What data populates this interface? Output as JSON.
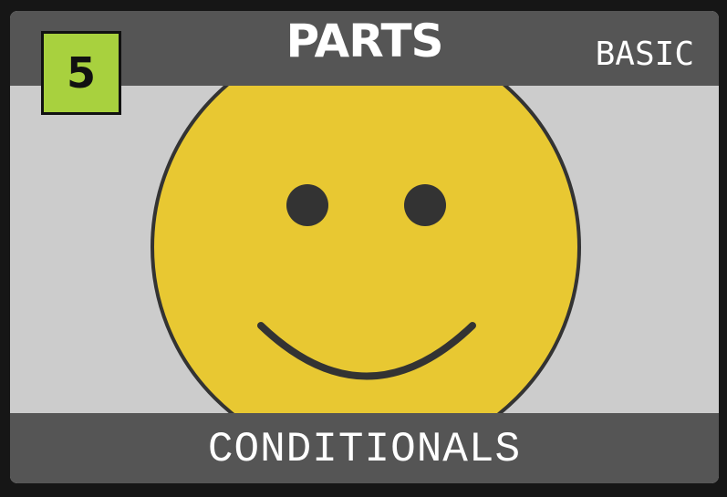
{
  "card": {
    "title": "PARTS",
    "difficulty": "BASIC",
    "level": "5",
    "category": "CONDITIONALS",
    "illustration_icon": "smiley-face-icon"
  },
  "colors": {
    "background": "#161616",
    "card_bg": "#cccccc",
    "bar": "#555555",
    "badge": "#a8d13e",
    "face": "#e8c832",
    "outline": "#333333",
    "text": "#ffffff"
  }
}
